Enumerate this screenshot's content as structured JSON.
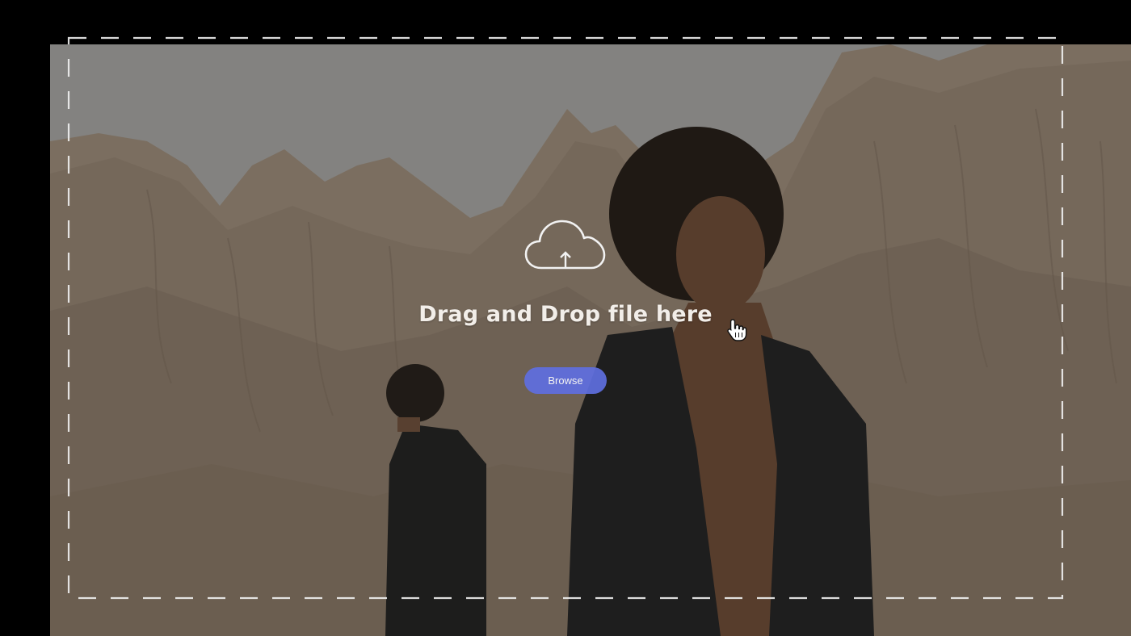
{
  "dropzone": {
    "title": "Drag and Drop file here",
    "browse_label": "Browse",
    "upload_icon": "cloud-upload-icon",
    "cursor_icon": "hand-pointer-icon"
  },
  "colors": {
    "accent": "#5f6fe0",
    "border": "#f1f1f1",
    "background": "#000000"
  }
}
